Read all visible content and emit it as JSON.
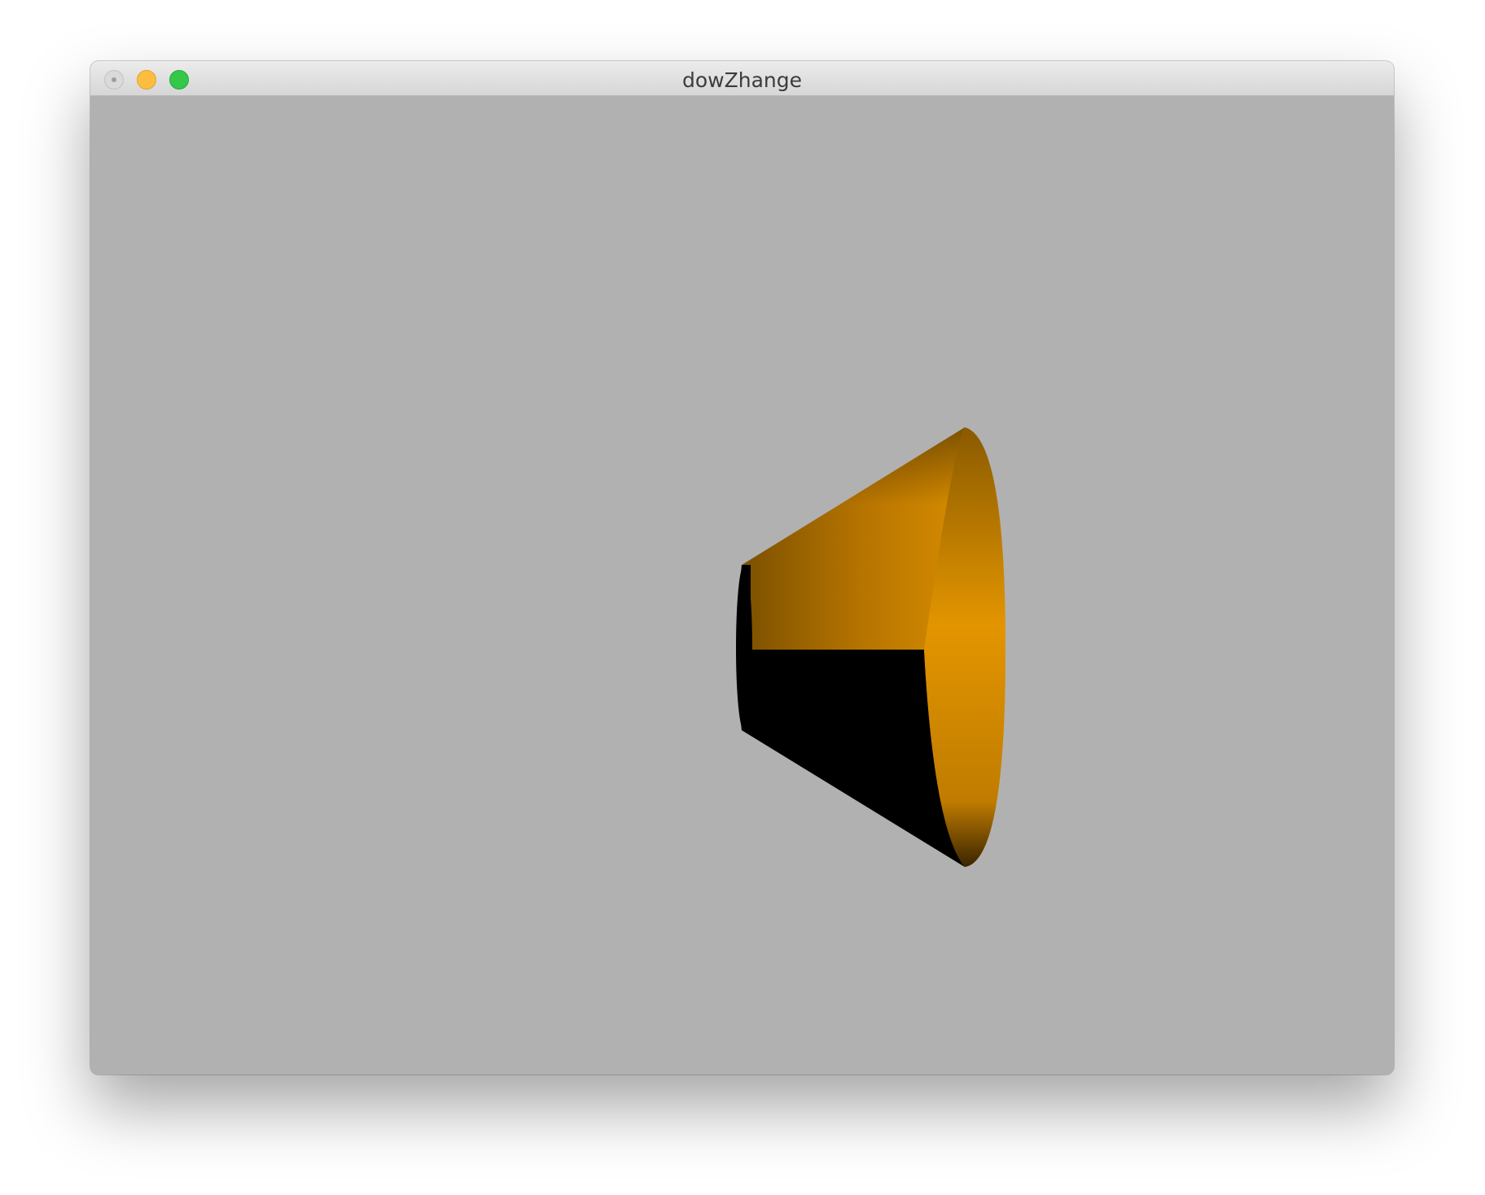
{
  "window": {
    "title": "dowZhange"
  },
  "titlebar": {
    "buttons": [
      {
        "name": "close",
        "color": "#dadada"
      },
      {
        "name": "minimize",
        "color": "#fdbd41"
      },
      {
        "name": "zoom",
        "color": "#34c84a"
      }
    ]
  },
  "viewport": {
    "background_color": "#b1b1b1",
    "object": "cone-frustum",
    "object_color": "#e39500",
    "shadow_color": "#000000"
  }
}
